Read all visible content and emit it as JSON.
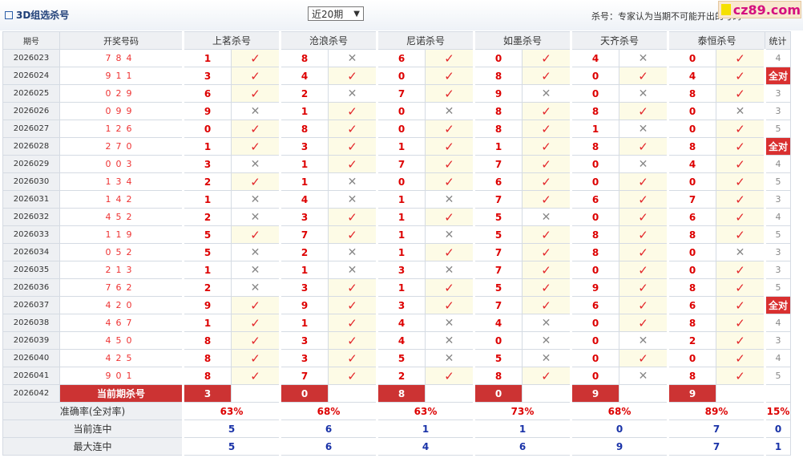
{
  "header": {
    "title": "3D组选杀号",
    "period_select": "近20期",
    "kill_note": "杀号：专家认为当期不可能开出的号码",
    "brand": "cz89.com"
  },
  "columns": {
    "issue": "期号",
    "draw": "开奖号码",
    "experts": [
      "上茗杀号",
      "沧浪杀号",
      "尼诺杀号",
      "如墨杀号",
      "天齐杀号",
      "泰恒杀号"
    ],
    "stat": "统计"
  },
  "symbols": {
    "ok": "✓",
    "no": "✕"
  },
  "rows": [
    {
      "issue": "2026023",
      "draw": "784",
      "kills": [
        {
          "n": "1",
          "ok": true
        },
        {
          "n": "8",
          "ok": false
        },
        {
          "n": "6",
          "ok": true
        },
        {
          "n": "0",
          "ok": true
        },
        {
          "n": "4",
          "ok": false
        },
        {
          "n": "0",
          "ok": true
        }
      ],
      "stat": "4",
      "all": false
    },
    {
      "issue": "2026024",
      "draw": "911",
      "kills": [
        {
          "n": "3",
          "ok": true
        },
        {
          "n": "4",
          "ok": true
        },
        {
          "n": "0",
          "ok": true
        },
        {
          "n": "8",
          "ok": true
        },
        {
          "n": "0",
          "ok": true
        },
        {
          "n": "4",
          "ok": true
        }
      ],
      "stat": "全对",
      "all": true
    },
    {
      "issue": "2026025",
      "draw": "029",
      "kills": [
        {
          "n": "6",
          "ok": true
        },
        {
          "n": "2",
          "ok": false
        },
        {
          "n": "7",
          "ok": true
        },
        {
          "n": "9",
          "ok": false
        },
        {
          "n": "0",
          "ok": false
        },
        {
          "n": "8",
          "ok": true
        }
      ],
      "stat": "3",
      "all": false
    },
    {
      "issue": "2026026",
      "draw": "099",
      "kills": [
        {
          "n": "9",
          "ok": false
        },
        {
          "n": "1",
          "ok": true
        },
        {
          "n": "0",
          "ok": false
        },
        {
          "n": "8",
          "ok": true
        },
        {
          "n": "8",
          "ok": true
        },
        {
          "n": "0",
          "ok": false
        }
      ],
      "stat": "3",
      "all": false
    },
    {
      "issue": "2026027",
      "draw": "126",
      "kills": [
        {
          "n": "0",
          "ok": true
        },
        {
          "n": "8",
          "ok": true
        },
        {
          "n": "0",
          "ok": true
        },
        {
          "n": "8",
          "ok": true
        },
        {
          "n": "1",
          "ok": false
        },
        {
          "n": "0",
          "ok": true
        }
      ],
      "stat": "5",
      "all": false
    },
    {
      "issue": "2026028",
      "draw": "270",
      "kills": [
        {
          "n": "1",
          "ok": true
        },
        {
          "n": "3",
          "ok": true
        },
        {
          "n": "1",
          "ok": true
        },
        {
          "n": "1",
          "ok": true
        },
        {
          "n": "8",
          "ok": true
        },
        {
          "n": "8",
          "ok": true
        }
      ],
      "stat": "全对",
      "all": true
    },
    {
      "issue": "2026029",
      "draw": "003",
      "kills": [
        {
          "n": "3",
          "ok": false
        },
        {
          "n": "1",
          "ok": true
        },
        {
          "n": "7",
          "ok": true
        },
        {
          "n": "7",
          "ok": true
        },
        {
          "n": "0",
          "ok": false
        },
        {
          "n": "4",
          "ok": true
        }
      ],
      "stat": "4",
      "all": false
    },
    {
      "issue": "2026030",
      "draw": "134",
      "kills": [
        {
          "n": "2",
          "ok": true
        },
        {
          "n": "1",
          "ok": false
        },
        {
          "n": "0",
          "ok": true
        },
        {
          "n": "6",
          "ok": true
        },
        {
          "n": "0",
          "ok": true
        },
        {
          "n": "0",
          "ok": true
        }
      ],
      "stat": "5",
      "all": false
    },
    {
      "issue": "2026031",
      "draw": "142",
      "kills": [
        {
          "n": "1",
          "ok": false
        },
        {
          "n": "4",
          "ok": false
        },
        {
          "n": "1",
          "ok": false
        },
        {
          "n": "7",
          "ok": true
        },
        {
          "n": "6",
          "ok": true
        },
        {
          "n": "7",
          "ok": true
        }
      ],
      "stat": "3",
      "all": false
    },
    {
      "issue": "2026032",
      "draw": "452",
      "kills": [
        {
          "n": "2",
          "ok": false
        },
        {
          "n": "3",
          "ok": true
        },
        {
          "n": "1",
          "ok": true
        },
        {
          "n": "5",
          "ok": false
        },
        {
          "n": "0",
          "ok": true
        },
        {
          "n": "6",
          "ok": true
        }
      ],
      "stat": "4",
      "all": false
    },
    {
      "issue": "2026033",
      "draw": "119",
      "kills": [
        {
          "n": "5",
          "ok": true
        },
        {
          "n": "7",
          "ok": true
        },
        {
          "n": "1",
          "ok": false
        },
        {
          "n": "5",
          "ok": true
        },
        {
          "n": "8",
          "ok": true
        },
        {
          "n": "8",
          "ok": true
        }
      ],
      "stat": "5",
      "all": false
    },
    {
      "issue": "2026034",
      "draw": "052",
      "kills": [
        {
          "n": "5",
          "ok": false
        },
        {
          "n": "2",
          "ok": false
        },
        {
          "n": "1",
          "ok": true
        },
        {
          "n": "7",
          "ok": true
        },
        {
          "n": "8",
          "ok": true
        },
        {
          "n": "0",
          "ok": false
        }
      ],
      "stat": "3",
      "all": false
    },
    {
      "issue": "2026035",
      "draw": "213",
      "kills": [
        {
          "n": "1",
          "ok": false
        },
        {
          "n": "1",
          "ok": false
        },
        {
          "n": "3",
          "ok": false
        },
        {
          "n": "7",
          "ok": true
        },
        {
          "n": "0",
          "ok": true
        },
        {
          "n": "0",
          "ok": true
        }
      ],
      "stat": "3",
      "all": false
    },
    {
      "issue": "2026036",
      "draw": "762",
      "kills": [
        {
          "n": "2",
          "ok": false
        },
        {
          "n": "3",
          "ok": true
        },
        {
          "n": "1",
          "ok": true
        },
        {
          "n": "5",
          "ok": true
        },
        {
          "n": "9",
          "ok": true
        },
        {
          "n": "8",
          "ok": true
        }
      ],
      "stat": "5",
      "all": false
    },
    {
      "issue": "2026037",
      "draw": "420",
      "kills": [
        {
          "n": "9",
          "ok": true
        },
        {
          "n": "9",
          "ok": true
        },
        {
          "n": "3",
          "ok": true
        },
        {
          "n": "7",
          "ok": true
        },
        {
          "n": "6",
          "ok": true
        },
        {
          "n": "6",
          "ok": true
        }
      ],
      "stat": "全对",
      "all": true
    },
    {
      "issue": "2026038",
      "draw": "467",
      "kills": [
        {
          "n": "1",
          "ok": true
        },
        {
          "n": "1",
          "ok": true
        },
        {
          "n": "4",
          "ok": false
        },
        {
          "n": "4",
          "ok": false
        },
        {
          "n": "0",
          "ok": true
        },
        {
          "n": "8",
          "ok": true
        }
      ],
      "stat": "4",
      "all": false
    },
    {
      "issue": "2026039",
      "draw": "450",
      "kills": [
        {
          "n": "8",
          "ok": true
        },
        {
          "n": "3",
          "ok": true
        },
        {
          "n": "4",
          "ok": false
        },
        {
          "n": "0",
          "ok": false
        },
        {
          "n": "0",
          "ok": false
        },
        {
          "n": "2",
          "ok": true
        }
      ],
      "stat": "3",
      "all": false
    },
    {
      "issue": "2026040",
      "draw": "425",
      "kills": [
        {
          "n": "8",
          "ok": true
        },
        {
          "n": "3",
          "ok": true
        },
        {
          "n": "5",
          "ok": false
        },
        {
          "n": "5",
          "ok": false
        },
        {
          "n": "0",
          "ok": true
        },
        {
          "n": "0",
          "ok": true
        }
      ],
      "stat": "4",
      "all": false
    },
    {
      "issue": "2026041",
      "draw": "901",
      "kills": [
        {
          "n": "8",
          "ok": true
        },
        {
          "n": "7",
          "ok": true
        },
        {
          "n": "2",
          "ok": true
        },
        {
          "n": "8",
          "ok": true
        },
        {
          "n": "0",
          "ok": false
        },
        {
          "n": "8",
          "ok": true
        }
      ],
      "stat": "5",
      "all": false
    }
  ],
  "current": {
    "issue": "2026042",
    "label": "当前期杀号",
    "kills": [
      "3",
      "0",
      "8",
      "0",
      "9",
      "9"
    ]
  },
  "footer": [
    {
      "label": "准确率(全对率)",
      "values": [
        "63%",
        "68%",
        "63%",
        "73%",
        "68%",
        "89%"
      ],
      "stat": "15%",
      "cls": "rate"
    },
    {
      "label": "当前连中",
      "values": [
        "5",
        "6",
        "1",
        "1",
        "0",
        "7"
      ],
      "stat": "0",
      "cls": "streak"
    },
    {
      "label": "最大连中",
      "values": [
        "5",
        "6",
        "4",
        "6",
        "9",
        "7"
      ],
      "stat": "1",
      "cls": "streak"
    }
  ]
}
